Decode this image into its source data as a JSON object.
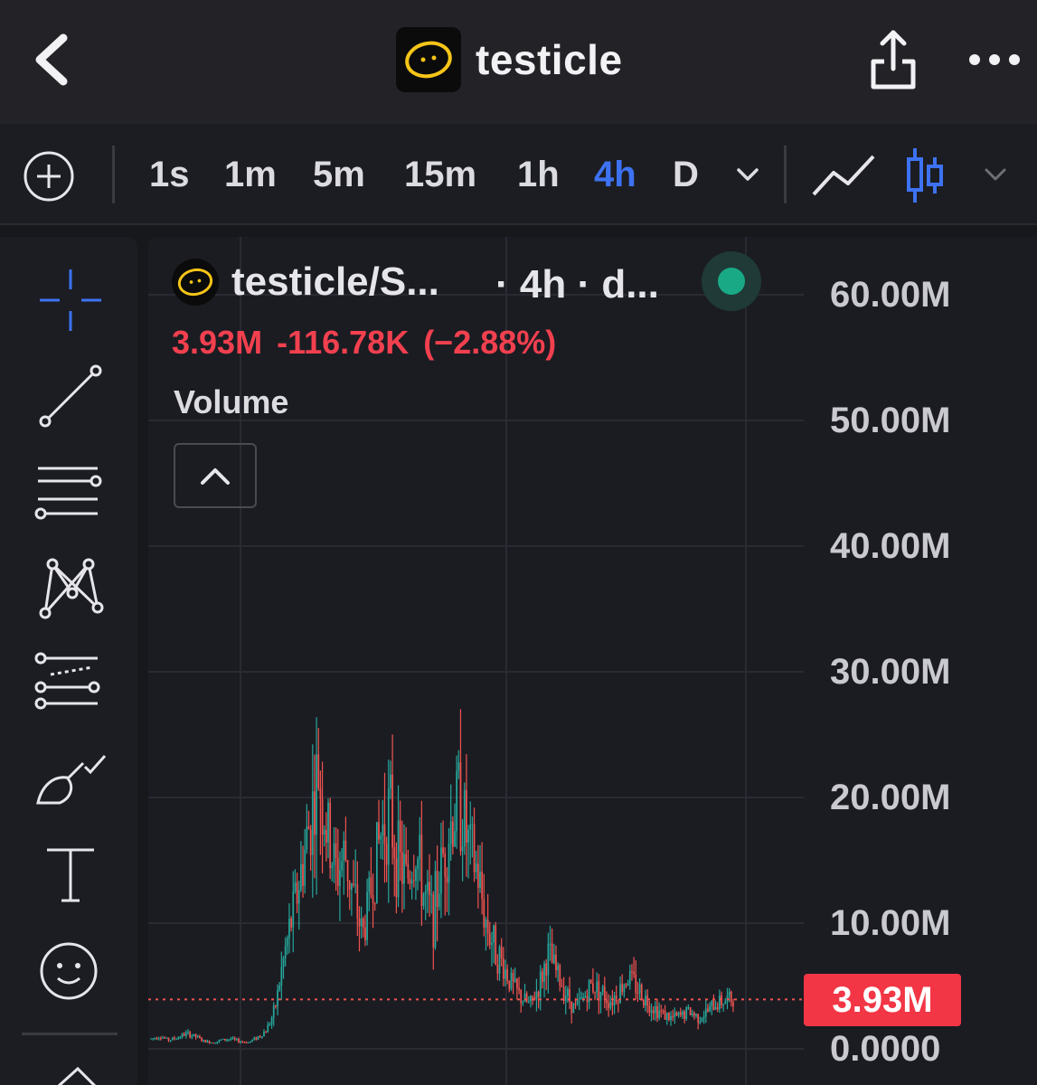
{
  "header": {
    "title": "testicle",
    "icons": {
      "back": "chevron-left-icon",
      "share": "share-icon",
      "more": "more-dots-icon",
      "logo": "egg-face-logo"
    }
  },
  "toolbar": {
    "timeframes": [
      "1s",
      "1m",
      "5m",
      "15m",
      "1h",
      "4h",
      "D"
    ],
    "active_timeframe": "4h",
    "accent_color": "#3d72f2",
    "icons": {
      "add": "add-indicator-icon",
      "more_tf": "chevron-down-icon",
      "line": "line-chart-icon",
      "candles": "candlestick-icon"
    }
  },
  "drawing_tools": [
    "crosshair-icon",
    "trend-line-icon",
    "horizontal-lines-icon",
    "pattern-icon",
    "fib-channel-icon",
    "brush-icon",
    "text-icon",
    "emoji-icon"
  ],
  "legend": {
    "pair": "testicle/S...",
    "interval": "· 4h · d...",
    "last_price": "3.93M",
    "change": "-116.78K (−2.88%)",
    "status_color": "#1aa985",
    "down_color": "#f23645"
  },
  "volume_label": "Volume",
  "price_badge": "3.93M",
  "chart_data": {
    "type": "candlestick",
    "y_ticks": [
      "60.00M",
      "50.00M",
      "40.00M",
      "30.00M",
      "20.00M",
      "10.00M",
      "0.0000"
    ],
    "ylim": [
      0,
      60000000
    ],
    "last_value": 3930000,
    "up_color": "#26a69a",
    "down_color": "#ef5350",
    "grid": true,
    "series_shape": [
      0.8,
      1.0,
      0.7,
      0.9,
      1.2,
      1.0,
      0.6,
      0.5,
      0.7,
      0.8,
      0.6,
      0.5,
      0.9,
      1.4,
      3.0,
      7.0,
      10.5,
      14.0,
      18.0,
      22.0,
      17.0,
      14.0,
      15.5,
      12.0,
      9.0,
      13.0,
      17.0,
      19.0,
      15.0,
      13.5,
      16.0,
      12.0,
      10.5,
      15.0,
      18.0,
      20.0,
      16.0,
      14.0,
      10.0,
      8.0,
      6.5,
      5.0,
      4.0,
      3.5,
      5.0,
      7.5,
      6.0,
      4.5,
      3.2,
      4.0,
      5.2,
      4.6,
      3.8,
      4.5,
      5.8,
      5.0,
      4.0,
      3.3,
      2.8,
      2.4,
      2.6,
      3.0,
      2.5,
      2.9,
      3.6,
      3.9,
      3.93
    ]
  }
}
